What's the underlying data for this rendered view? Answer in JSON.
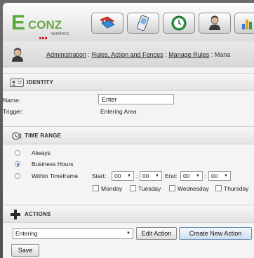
{
  "brand": {
    "letter": "E",
    "name": "CONZ",
    "tagline": "wireless"
  },
  "toolbar": {
    "buttons": [
      {
        "icon": "tags-icon"
      },
      {
        "icon": "phone-icon"
      },
      {
        "icon": "clock-icon"
      },
      {
        "icon": "user-icon"
      },
      {
        "icon": "chart-icon"
      }
    ]
  },
  "breadcrumb": {
    "items": [
      "Administration",
      "Rules, Action and Fences",
      "Manage Rules",
      "Mana"
    ],
    "separator": ":"
  },
  "identity": {
    "title": "IDENTITY",
    "name_label": "Name:",
    "name_value": "Enter",
    "trigger_label": "Trigger:",
    "trigger_value": "Entering Area"
  },
  "time_range": {
    "title": "TIME RANGE",
    "options": [
      "Always",
      "Business Hours",
      "Within Timeframe"
    ],
    "selected": "Business Hours",
    "start_label": "Start:",
    "start_hour": "00",
    "start_min": "00",
    "end_label": "End:",
    "end_hour": "00",
    "end_min": "00",
    "colon": ":",
    "days": [
      "Monday",
      "Tuesday",
      "Wednesday",
      "Thursday"
    ]
  },
  "actions": {
    "title": "ACTIONS",
    "selected_action": "Entering",
    "edit_label": "Edit Action",
    "create_label": "Create New Action"
  },
  "footer": {
    "save_label": "Save"
  },
  "colors": {
    "brand_green": "#5aa83a",
    "brand_red": "#dd2222",
    "accent_blue": "#1a5fb4"
  }
}
